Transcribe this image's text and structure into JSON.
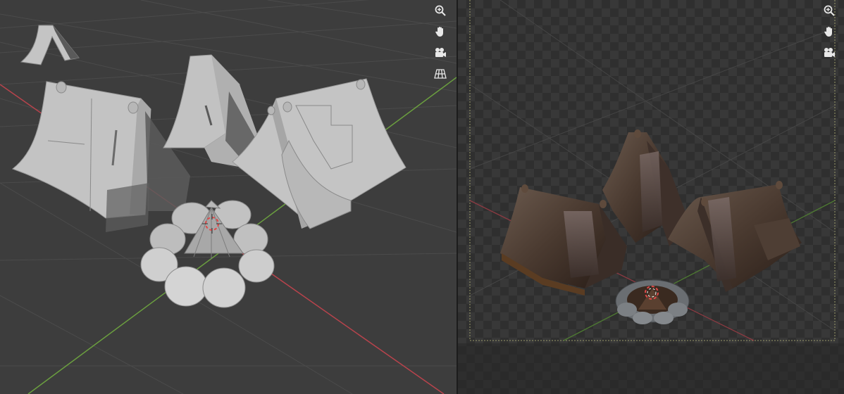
{
  "left_viewport": {
    "mode": "solid",
    "background": "#3d3d3d",
    "grid_color": "#4a4a4a",
    "axis_x_color": "#c0424e",
    "axis_y_color": "#6ea341",
    "nav_icons": [
      "zoom-icon",
      "pan-hand-icon",
      "camera-view-icon",
      "perspective-grid-icon"
    ]
  },
  "right_viewport": {
    "mode": "rendered",
    "background": "checkerboard",
    "nav_icons": [
      "zoom-icon",
      "pan-hand-icon",
      "camera-view-icon"
    ]
  },
  "scene_objects": [
    "small-tent",
    "left-tent",
    "middle-tent",
    "right-tent",
    "campfire",
    "3d-cursor"
  ]
}
